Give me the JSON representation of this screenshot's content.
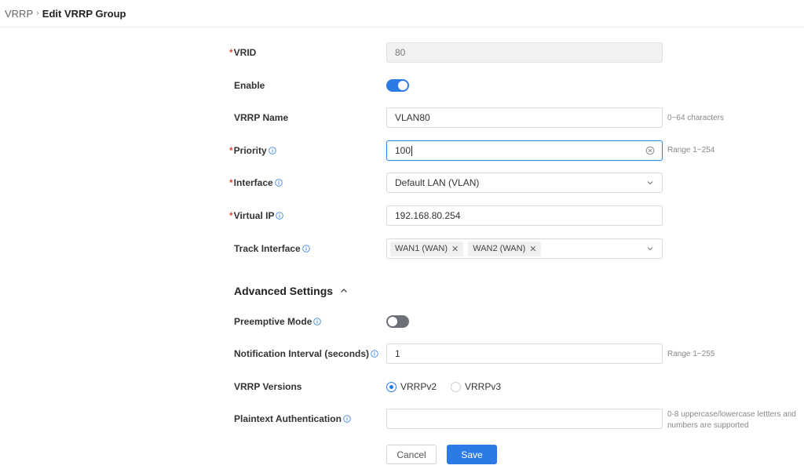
{
  "breadcrumb": {
    "parent": "VRRP",
    "separator": "›",
    "current": "Edit VRRP Group"
  },
  "form": {
    "vrid": {
      "label": "VRID",
      "value": "80"
    },
    "enable": {
      "label": "Enable",
      "state": "on"
    },
    "vrrp_name": {
      "label": "VRRP Name",
      "value": "VLAN80",
      "hint": "0~64 characters"
    },
    "priority": {
      "label": "Priority",
      "value": "100",
      "hint": "Range 1~254"
    },
    "interface": {
      "label": "Interface",
      "value": "Default LAN (VLAN)"
    },
    "virtual_ip": {
      "label": "Virtual IP",
      "value": "192.168.80.254"
    },
    "track_interface": {
      "label": "Track Interface",
      "tags": [
        "WAN1 (WAN)",
        "WAN2 (WAN)"
      ],
      "remove_glyph": "✕"
    }
  },
  "advanced": {
    "title": "Advanced Settings",
    "preemptive_mode": {
      "label": "Preemptive Mode",
      "state": "off"
    },
    "notification_interval": {
      "label": "Notification Interval (seconds)",
      "value": "1",
      "hint": "Range 1~255"
    },
    "vrrp_versions": {
      "label": "VRRP Versions",
      "options": [
        "VRRPv2",
        "VRRPv3"
      ],
      "selected": "VRRPv2"
    },
    "plaintext_auth": {
      "label": "Plaintext Authentication",
      "value": "",
      "hint_line1": "0-8 uppercase/lowercase lettters and",
      "hint_line2": "numbers are supported"
    }
  },
  "actions": {
    "cancel": "Cancel",
    "save": "Save"
  },
  "required_mark": "*",
  "colors": {
    "accent": "#2c7be5",
    "required": "#e5453b",
    "toggle_off": "#6e7079"
  }
}
